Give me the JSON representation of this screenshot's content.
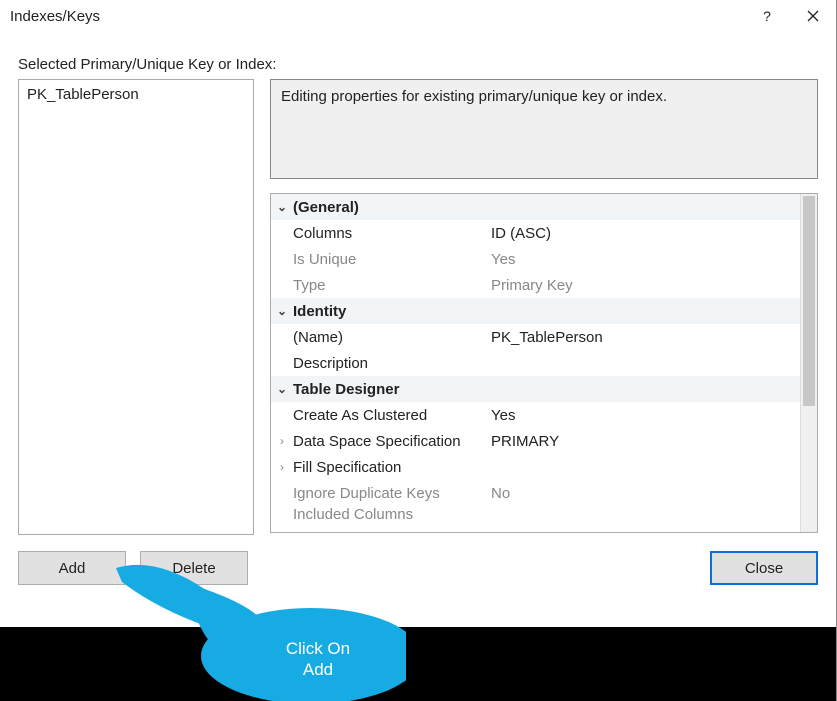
{
  "title": "Indexes/Keys",
  "subheading": "Selected Primary/Unique Key or Index:",
  "list_items": [
    "PK_TablePerson"
  ],
  "description": "Editing properties for existing primary/unique key or index.",
  "properties": {
    "sections": [
      {
        "name": "(General)",
        "rows": [
          {
            "label": "Columns",
            "value": "ID (ASC)",
            "disabled": false
          },
          {
            "label": "Is Unique",
            "value": "Yes",
            "disabled": true
          },
          {
            "label": "Type",
            "value": "Primary Key",
            "disabled": true
          }
        ]
      },
      {
        "name": "Identity",
        "rows": [
          {
            "label": "(Name)",
            "value": "PK_TablePerson",
            "disabled": false
          },
          {
            "label": "Description",
            "value": "",
            "disabled": false
          }
        ]
      },
      {
        "name": "Table Designer",
        "rows": [
          {
            "label": "Create As Clustered",
            "value": "Yes",
            "disabled": false
          },
          {
            "label": "Data Space Specification",
            "value": "PRIMARY",
            "disabled": false,
            "expand": true
          },
          {
            "label": "Fill Specification",
            "value": "",
            "disabled": false,
            "expand": true
          },
          {
            "label": "Ignore Duplicate Keys",
            "value": "No",
            "disabled": true
          },
          {
            "label": "Included Columns",
            "value": "",
            "disabled": true,
            "cutoff": true
          }
        ]
      }
    ]
  },
  "buttons": {
    "add": "Add",
    "delete": "Delete",
    "close": "Close"
  },
  "callout_line1": "Click On",
  "callout_line2": "Add"
}
